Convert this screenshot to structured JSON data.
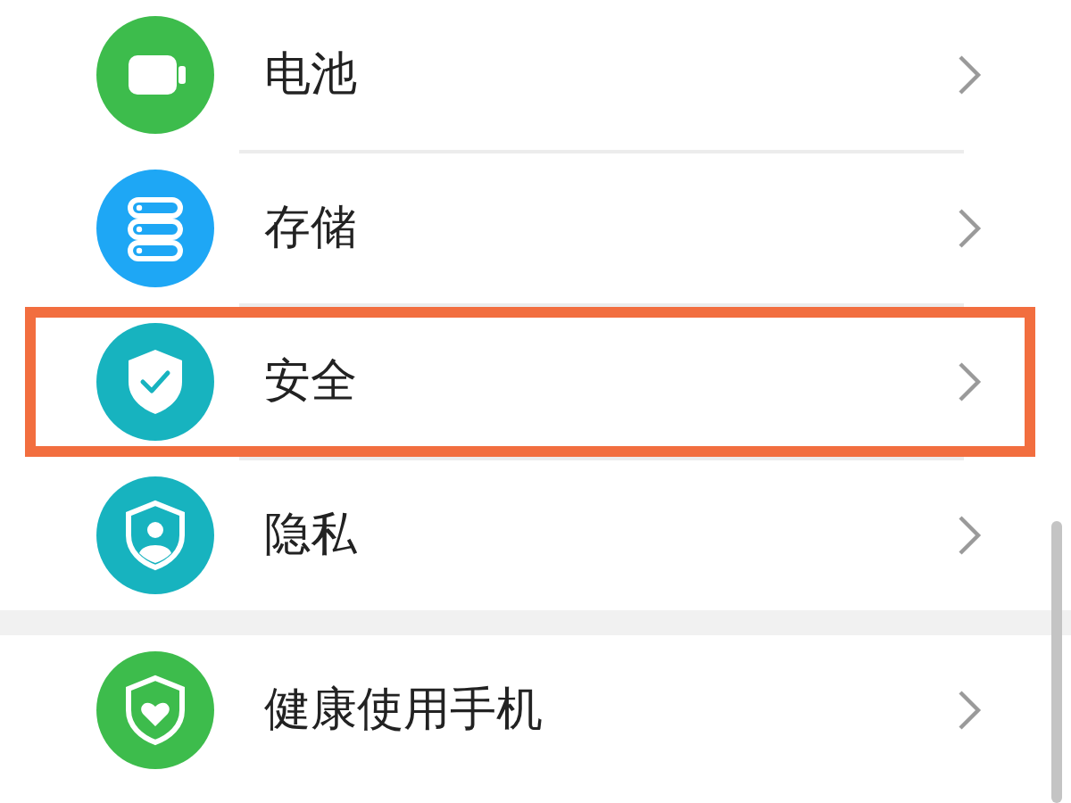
{
  "groups": [
    {
      "items": [
        {
          "kind": "battery",
          "label": "电池",
          "highlighted": false
        },
        {
          "kind": "storage",
          "label": "存储",
          "highlighted": false
        },
        {
          "kind": "security",
          "label": "安全",
          "highlighted": true
        },
        {
          "kind": "privacy",
          "label": "隐私",
          "highlighted": false
        }
      ]
    },
    {
      "items": [
        {
          "kind": "health",
          "label": "健康使用手机",
          "highlighted": false
        }
      ]
    }
  ]
}
